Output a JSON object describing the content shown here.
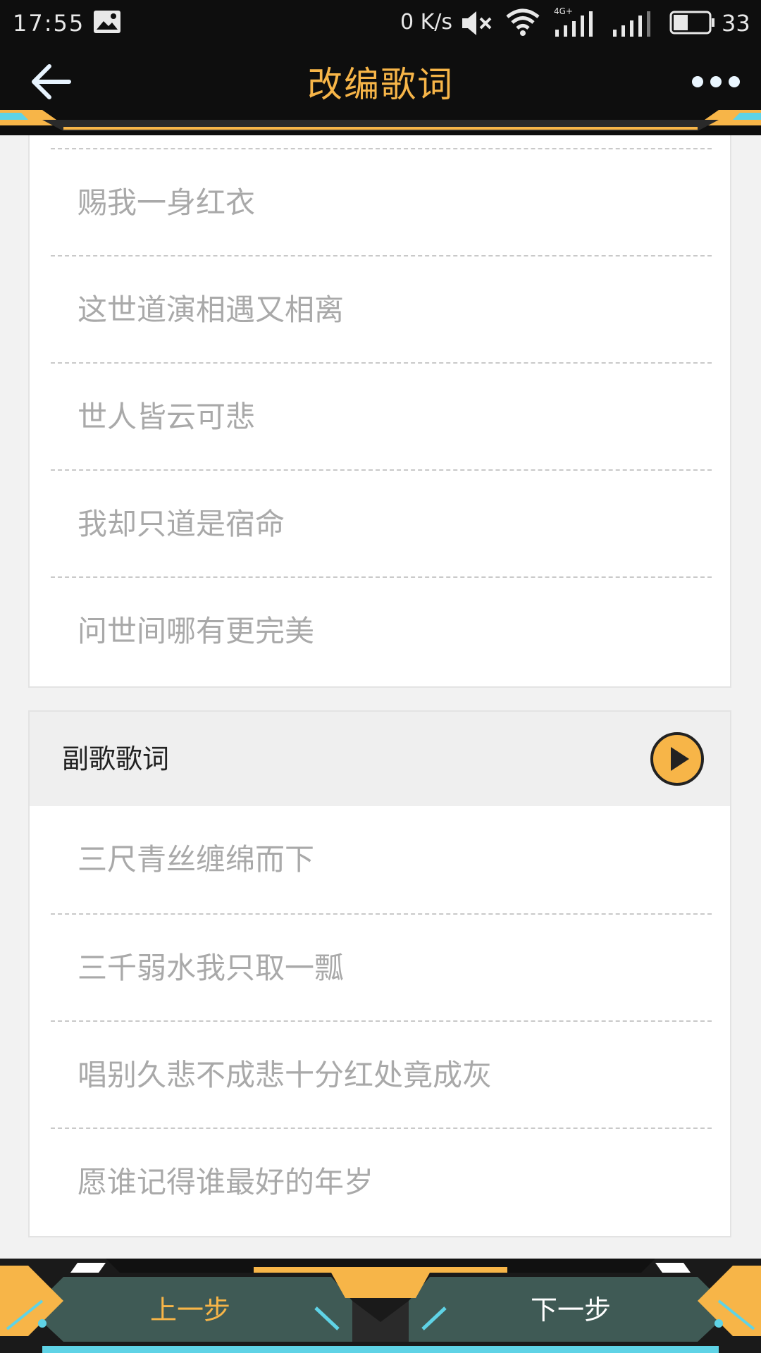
{
  "status_bar": {
    "time": "17:55",
    "net_speed": "0 K/s",
    "battery": "33",
    "icons": [
      "image-icon",
      "mute-icon",
      "wifi-icon",
      "4g-signal-icon",
      "signal-icon",
      "battery-icon"
    ]
  },
  "nav": {
    "title": "改编歌词",
    "back_icon": "back-arrow-icon",
    "more_icon": "more-dots-icon"
  },
  "verse": {
    "lines": [
      "赐我一身红衣",
      "这世道演相遇又相离",
      "世人皆云可悲",
      "我却只道是宿命",
      "问世间哪有更完美"
    ]
  },
  "chorus": {
    "title": "副歌歌词",
    "lines": [
      "三尺青丝缠绵而下",
      "三千弱水我只取一瓢",
      "唱别久悲不成悲十分红处竟成灰",
      "愿谁记得谁最好的年岁"
    ]
  },
  "footer": {
    "prev_label": "上一步",
    "next_label": "下一步"
  },
  "colors": {
    "accent": "#f7b548",
    "dark": "#0e0e0e",
    "lyric_text": "#a9a9a9",
    "footer_panel": "#3f5a55"
  }
}
